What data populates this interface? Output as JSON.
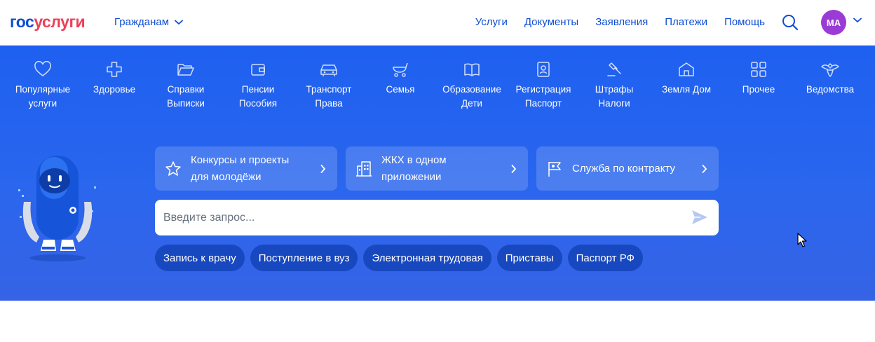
{
  "header": {
    "logo_part1": "гос",
    "logo_part2": "услуги",
    "audience": "Гражданам",
    "nav": [
      "Услуги",
      "Документы",
      "Заявления",
      "Платежи",
      "Помощь"
    ],
    "avatar_initials": "МА"
  },
  "categories": [
    {
      "line1": "Популярные",
      "line2": "услуги",
      "icon": "heart-icon"
    },
    {
      "line1": "Здоровье",
      "line2": "",
      "icon": "medical-cross-icon"
    },
    {
      "line1": "Справки",
      "line2": "Выписки",
      "icon": "folder-icon"
    },
    {
      "line1": "Пенсии",
      "line2": "Пособия",
      "icon": "wallet-icon"
    },
    {
      "line1": "Транспорт",
      "line2": "Права",
      "icon": "car-icon"
    },
    {
      "line1": "Семья",
      "line2": "",
      "icon": "stroller-icon"
    },
    {
      "line1": "Образование",
      "line2": "Дети",
      "icon": "book-icon"
    },
    {
      "line1": "Регистрация",
      "line2": "Паспорт",
      "icon": "id-card-icon"
    },
    {
      "line1": "Штрафы",
      "line2": "Налоги",
      "icon": "gavel-icon"
    },
    {
      "line1": "Земля Дом",
      "line2": "",
      "icon": "house-icon"
    },
    {
      "line1": "Прочее",
      "line2": "",
      "icon": "grid-icon"
    },
    {
      "line1": "Ведомства",
      "line2": "",
      "icon": "emblem-icon"
    }
  ],
  "quick_links": [
    {
      "line1": "Конкурсы и проекты",
      "line2": "для молодёжи",
      "icon": "star-icon"
    },
    {
      "line1": "ЖКХ в одном",
      "line2": "приложении",
      "icon": "building-icon"
    },
    {
      "line1": "Служба по контракту",
      "line2": "",
      "icon": "flag-icon"
    }
  ],
  "search": {
    "placeholder": "Введите запрос..."
  },
  "chips": [
    "Запись к врачу",
    "Поступление в вуз",
    "Электронная трудовая",
    "Приставы",
    "Паспорт РФ"
  ],
  "colors": {
    "brand_blue": "#0d4cd3",
    "brand_red": "#ee3f58",
    "hero_blue": "#2a66ee",
    "avatar": "#9b3bd5"
  }
}
